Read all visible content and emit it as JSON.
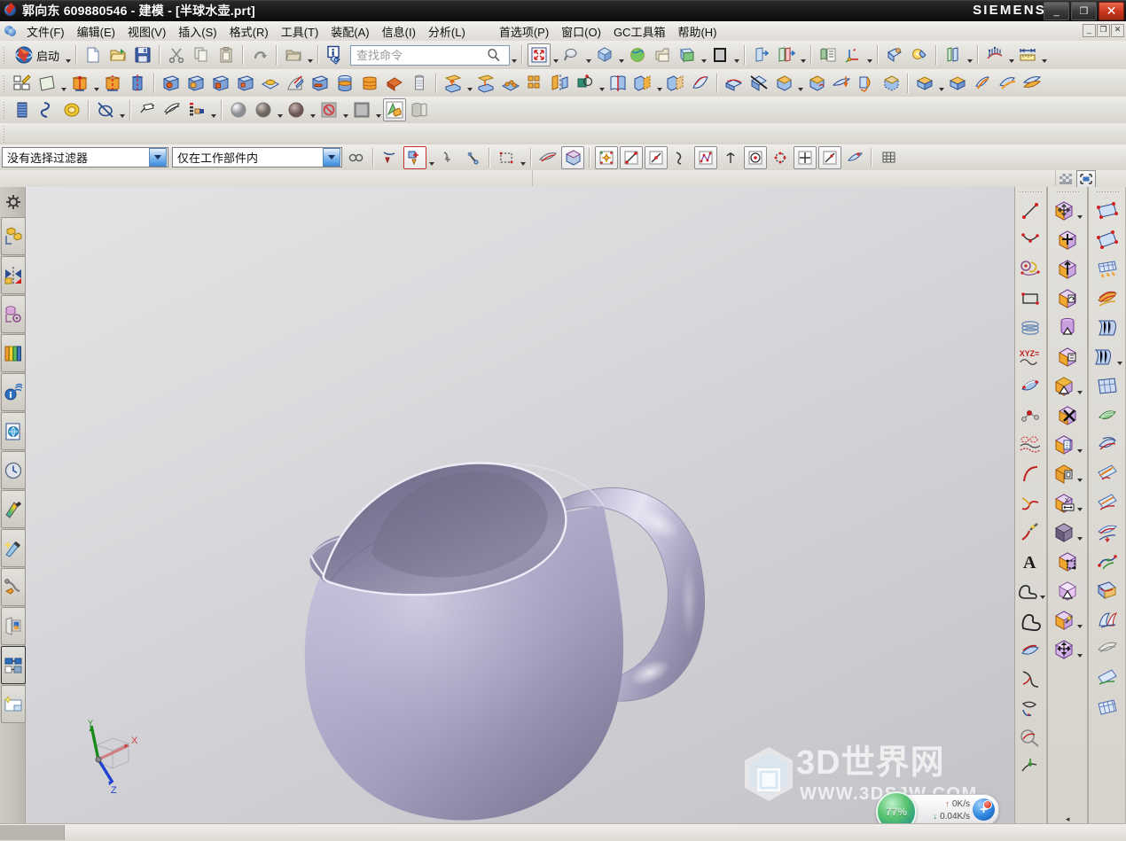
{
  "window": {
    "title": "郭向东 609880546 - 建模 - [半球水壶.prt]",
    "brand": "SIEMENS",
    "minimize_label": "_",
    "restore_label": "❐",
    "close_label": "✕"
  },
  "menubar": {
    "items": [
      {
        "label": "文件(F)",
        "name": "menu-file"
      },
      {
        "label": "编辑(E)",
        "name": "menu-edit"
      },
      {
        "label": "视图(V)",
        "name": "menu-view"
      },
      {
        "label": "插入(S)",
        "name": "menu-insert"
      },
      {
        "label": "格式(R)",
        "name": "menu-format"
      },
      {
        "label": "工具(T)",
        "name": "menu-tools"
      },
      {
        "label": "装配(A)",
        "name": "menu-assembly"
      },
      {
        "label": "信息(I)",
        "name": "menu-information"
      },
      {
        "label": "分析(L)",
        "name": "menu-analysis"
      },
      {
        "label": "首选项(P)",
        "name": "menu-preferences"
      },
      {
        "label": "窗口(O)",
        "name": "menu-window"
      },
      {
        "label": "GC工具箱",
        "name": "menu-gc-toolbox"
      },
      {
        "label": "帮助(H)",
        "name": "menu-help"
      }
    ],
    "doc_controls": [
      "_",
      "❐",
      "✕"
    ]
  },
  "toolbar_standard": {
    "start_label": "启动",
    "search_placeholder": "查找命令",
    "search_value": ""
  },
  "selection_bar": {
    "filter_value": "没有选择过滤器",
    "scope_value": "仅在工作部件内"
  },
  "graphics": {
    "triad": {
      "x_label": "X",
      "y_label": "Y",
      "z_label": "Z"
    },
    "model_name": "半球水壶",
    "body_color": "#a9a5c4",
    "background_top": "#e3e3e5",
    "background_bottom": "#c3c3c9"
  },
  "watermark": {
    "text": "3D世界网",
    "url": "WWW.3DSJW.COM"
  },
  "net_widget": {
    "percent": "77%",
    "upload": "0K/s",
    "download": "0.04K/s",
    "up_arrow": "↑",
    "down_arrow": "↓",
    "badge": "+"
  },
  "status_bar": {
    "message": ""
  },
  "resource_bar": {
    "items": [
      {
        "name": "resource-assembly-navigator",
        "title": "装配导航器"
      },
      {
        "name": "resource-constraint-navigator",
        "title": "约束导航器"
      },
      {
        "name": "resource-part-navigator",
        "title": "部件导航器"
      },
      {
        "name": "resource-reuse-library",
        "title": "重用库"
      },
      {
        "name": "resource-hd3d-tools",
        "title": "HD3D 工具"
      },
      {
        "name": "resource-web-browser",
        "title": "Web 浏览器"
      },
      {
        "name": "resource-history",
        "title": "历史记录"
      },
      {
        "name": "resource-system-materials",
        "title": "系统材料"
      },
      {
        "name": "resource-system-scene",
        "title": "系统场景"
      },
      {
        "name": "resource-process-studio",
        "title": "加工向导"
      },
      {
        "name": "resource-roles",
        "title": "角色"
      },
      {
        "name": "resource-system-visual",
        "title": "系统可视化"
      },
      {
        "name": "resource-full-screen",
        "title": "全屏"
      }
    ]
  },
  "right_panels": {
    "curve_tools": [
      "line-icon",
      "studio-spline-icon",
      "helix-icon",
      "rectangle-icon",
      "spiral-icon",
      "law-curve-icon",
      "section-curve-icon",
      "point-set-icon",
      "offset-curve-icon",
      "arc-icon",
      "text-icon",
      "region-boundary-icon",
      "region-icon",
      "bridge-curve-icon",
      "project-curve-icon",
      "combined-projection-icon",
      "intersection-curve-icon"
    ],
    "feature_tools": [
      "move-object-icon",
      "move-face-icon",
      "pull-face-icon",
      "copy-face-icon",
      "cylinder-taper-icon",
      "resize-face-icon",
      "taper-face-icon",
      "delete-face-icon",
      "copy-paste-face-icon",
      "offset-region-icon",
      "resize-length-icon",
      "shell-body-icon",
      "wrap-geometry-icon",
      "scale-body-icon",
      "sew-icon",
      "optimize-face-icon",
      "transform-icon"
    ],
    "surface_tools": [
      "four-point-surface-icon",
      "bounded-plane-icon",
      "through-curve-mesh-icon",
      "studio-surface-icon",
      "ruled-icon",
      "swept-icon",
      "through-curves-icon",
      "n-sided-surface-icon",
      "silhouette-flange-icon",
      "patch-icon",
      "trim-sheet-icon",
      "extend-sheet-icon",
      "offset-surface-icon",
      "bridge-surface-icon",
      "face-blend-icon",
      "aesthetic-blend-icon",
      "enlarge-icon",
      "untrim-icon"
    ]
  }
}
